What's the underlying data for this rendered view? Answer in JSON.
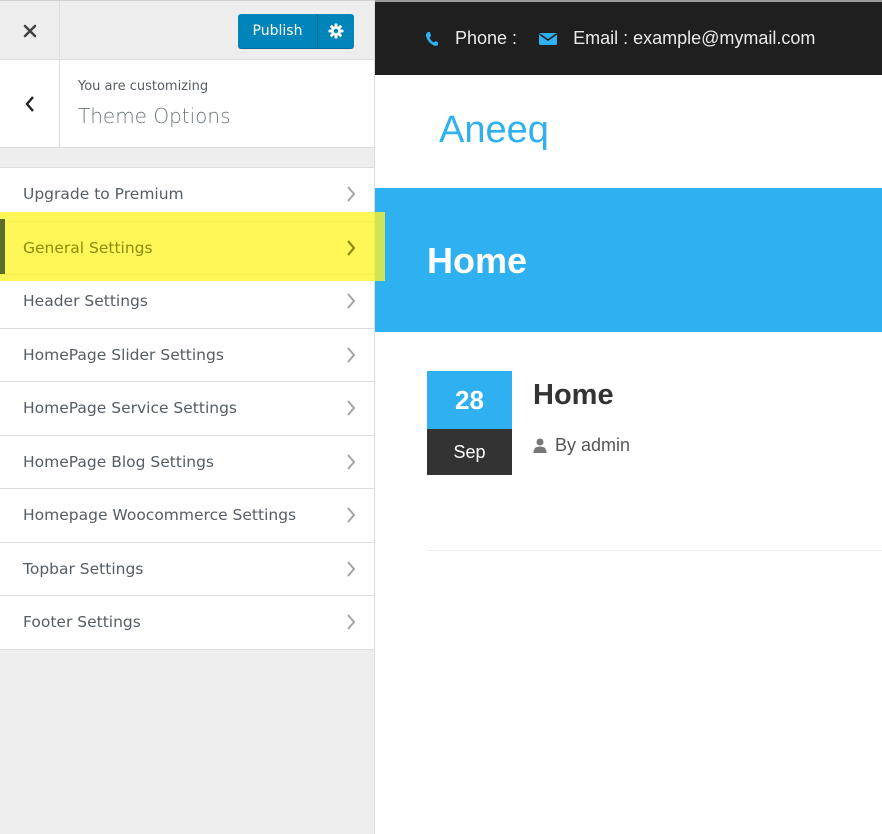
{
  "sidebar": {
    "close_icon": "close-icon",
    "publish_label": "Publish",
    "settings_icon": "gear-icon",
    "back_icon": "chevron-left-icon",
    "customizing_label": "You are customizing",
    "panel_title": "Theme Options",
    "sections": [
      {
        "label": "Upgrade to Premium",
        "highlighted": false
      },
      {
        "label": "General Settings",
        "highlighted": true
      },
      {
        "label": "Header Settings",
        "highlighted": false
      },
      {
        "label": "HomePage Slider Settings",
        "highlighted": false
      },
      {
        "label": "HomePage Service Settings",
        "highlighted": false
      },
      {
        "label": "HomePage Blog Settings",
        "highlighted": false
      },
      {
        "label": "Homepage Woocommerce Settings",
        "highlighted": false
      },
      {
        "label": "Topbar Settings",
        "highlighted": false
      },
      {
        "label": "Footer Settings",
        "highlighted": false
      }
    ]
  },
  "preview": {
    "topbar": {
      "phone_label": "Phone :",
      "email_label": "Email : example@mymail.com"
    },
    "site_title": "Aneeq",
    "banner_title": "Home",
    "post": {
      "day": "28",
      "month": "Sep",
      "title": "Home",
      "author": "By admin"
    }
  },
  "colors": {
    "accent": "#2fb0f1",
    "publish": "#0085ba",
    "topbar": "#1f1f1f",
    "highlight": "#ffff00"
  }
}
